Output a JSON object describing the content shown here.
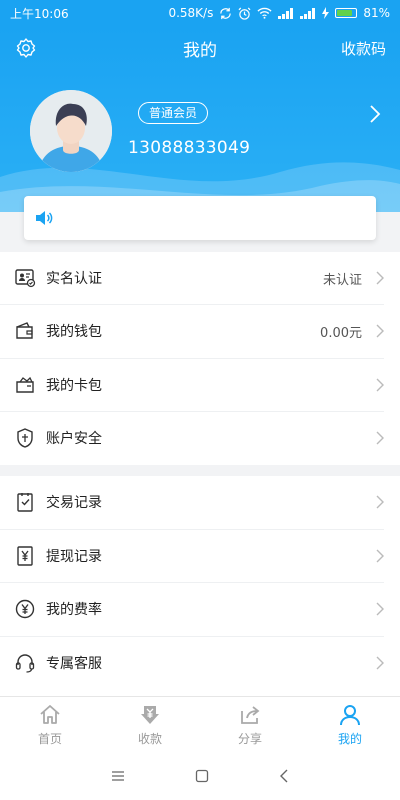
{
  "status_bar": {
    "time": "上午10:06",
    "speed": "0.58K/s",
    "battery_text": "81%",
    "battery_level": 0.81
  },
  "header": {
    "title": "我的",
    "pay_code": "收款码"
  },
  "profile": {
    "member_level": "普通会员",
    "phone": "13088833049"
  },
  "notice": {
    "text": ""
  },
  "list_one": [
    {
      "label": "实名认证",
      "value": "未认证",
      "icon": "id-card-icon"
    },
    {
      "label": "我的钱包",
      "value": "0.00元",
      "icon": "wallet-icon"
    },
    {
      "label": "我的卡包",
      "value": "",
      "icon": "card-pack-icon"
    },
    {
      "label": "账户安全",
      "value": "",
      "icon": "shield-icon"
    }
  ],
  "list_two": [
    {
      "label": "交易记录",
      "icon": "checklist-icon"
    },
    {
      "label": "提现记录",
      "icon": "yen-receipt-icon"
    },
    {
      "label": "我的费率",
      "icon": "yen-circle-icon"
    },
    {
      "label": "专属客服",
      "icon": "headset-icon"
    }
  ],
  "tabs": [
    {
      "label": "首页",
      "icon": "home-icon"
    },
    {
      "label": "收款",
      "icon": "receive-icon"
    },
    {
      "label": "分享",
      "icon": "share-icon"
    },
    {
      "label": "我的",
      "icon": "user-icon",
      "active": true
    }
  ],
  "colors": {
    "primary": "#1aa3f2",
    "inactive": "#999999"
  }
}
